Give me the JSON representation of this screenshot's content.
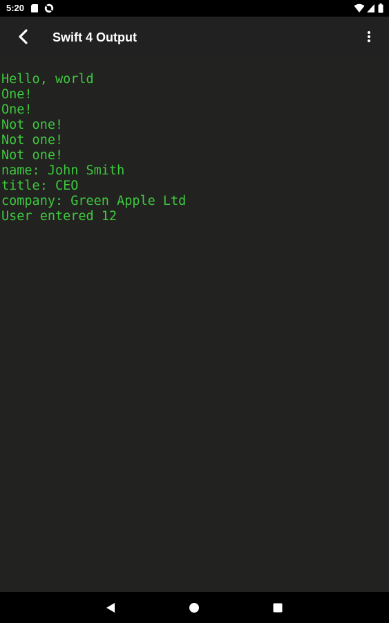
{
  "status_bar": {
    "time": "5:20",
    "icons": [
      "sd-card-icon",
      "sync-disabled-icon",
      "wifi-icon",
      "cellular-signal-icon",
      "battery-icon"
    ]
  },
  "app_bar": {
    "title": "Swift 4 Output",
    "back_icon": "chevron-left-icon",
    "menu_icon": "overflow-menu-icon"
  },
  "output": {
    "lines": [
      "Hello, world",
      "One!",
      "One!",
      "Not one!",
      "Not one!",
      "Not one!",
      "name: John Smith",
      "title: CEO",
      "company: Green Apple Ltd",
      "User entered 12"
    ]
  },
  "nav_bar": {
    "icons": [
      "back-triangle-icon",
      "home-circle-icon",
      "recents-square-icon"
    ]
  },
  "colors": {
    "background": "#222220",
    "app_bar": "#212121",
    "output_text": "#3ec93e",
    "system_bar": "#000000"
  }
}
